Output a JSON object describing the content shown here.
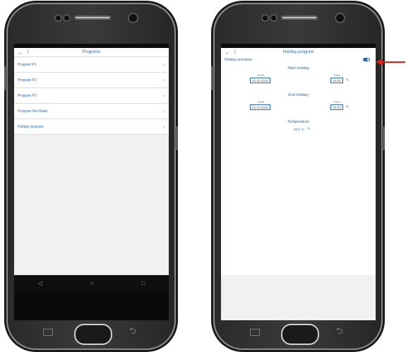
{
  "left_phone": {
    "status_left": "",
    "status_right": "",
    "header": {
      "back": "←",
      "bluetooth": "ᛒ",
      "title": "Programs"
    },
    "items": [
      {
        "label": "Program P1",
        "chevron": "›"
      },
      {
        "label": "Program P2",
        "chevron": "›"
      },
      {
        "label": "Program P3",
        "chevron": "›"
      },
      {
        "label": "Program Hot Water",
        "chevron": "›"
      },
      {
        "label": "Holiday program",
        "chevron": "›"
      }
    ],
    "nav": {
      "back": "◁",
      "home": "○",
      "recents": "□"
    },
    "hw_back": "⮌"
  },
  "right_phone": {
    "status_left": "",
    "status_right": "",
    "header": {
      "back": "←",
      "bluetooth": "ᛒ",
      "title": "Holiday program"
    },
    "activation_label": "Holiday activation",
    "activation_on": true,
    "start": {
      "title": "Start holiday",
      "date_label": "Date",
      "date_value": "01.01.2018",
      "time_label": "Time",
      "time_value": "00:00"
    },
    "end": {
      "title": "End holiday",
      "date_label": "Date",
      "date_value": "01.01.2018",
      "time_label": "Time",
      "time_value": "00:00"
    },
    "temperature": {
      "title": "Temperature",
      "value": "20,0 °C"
    },
    "hw_back": "⮌"
  },
  "colors": {
    "accent": "#2e6aa7",
    "arrow": "#e0201b"
  }
}
